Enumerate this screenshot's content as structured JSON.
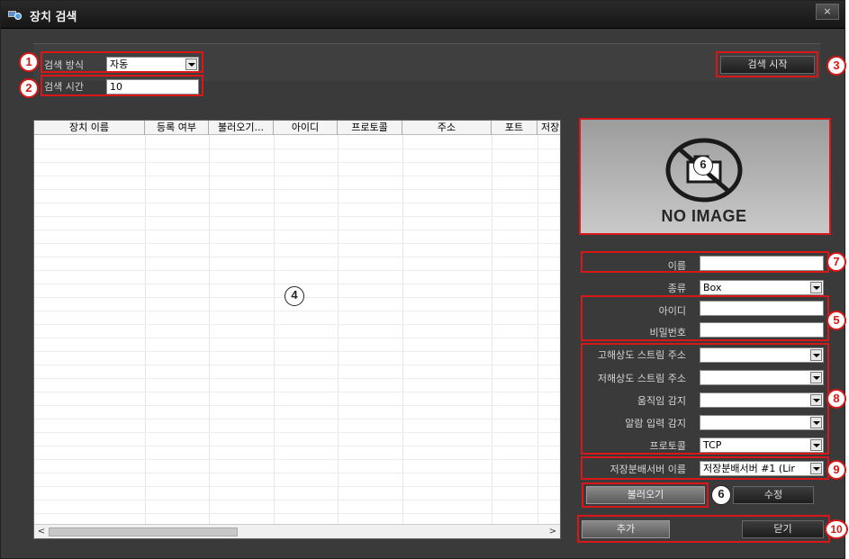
{
  "window": {
    "title": "장치 검색",
    "close_label": "×"
  },
  "search": {
    "method_label": "검색 방식",
    "method_value": "자동",
    "time_label": "검색 시간",
    "time_value": "10",
    "start_button": "검색 시작"
  },
  "table": {
    "columns": [
      "장치 이름",
      "등록 여부",
      "불러오기...",
      "아이디",
      "프로토콜",
      "주소",
      "포트",
      "저장"
    ],
    "left_arrow": "<",
    "right_arrow": ">"
  },
  "preview": {
    "no_image_text": "NO IMAGE"
  },
  "form": {
    "name_label": "이름",
    "name_value": "",
    "type_label": "종류",
    "type_value": "Box",
    "id_label": "아이디",
    "id_value": "",
    "password_label": "비밀번호",
    "password_value": "",
    "hires_label": "고해상도 스트림 주소",
    "hires_value": "",
    "lowres_label": "저해상도 스트림 주소",
    "lowres_value": "",
    "motion_label": "움직임 감지",
    "motion_value": "",
    "alarm_label": "알람 입력 감지",
    "alarm_value": "",
    "protocol_label": "프로토콜",
    "protocol_value": "TCP",
    "storage_label": "저장분배서버 이름",
    "storage_value": "저장분배서버 #1 (Lir"
  },
  "buttons": {
    "load": "불러오기",
    "edit": "수정",
    "add": "추가",
    "close": "닫기"
  },
  "annotations": [
    "1",
    "2",
    "3",
    "4",
    "5",
    "6",
    "7",
    "8",
    "9",
    "10"
  ],
  "colors": {
    "highlight": "#d81818",
    "window_bg": "#3a3a3a"
  }
}
